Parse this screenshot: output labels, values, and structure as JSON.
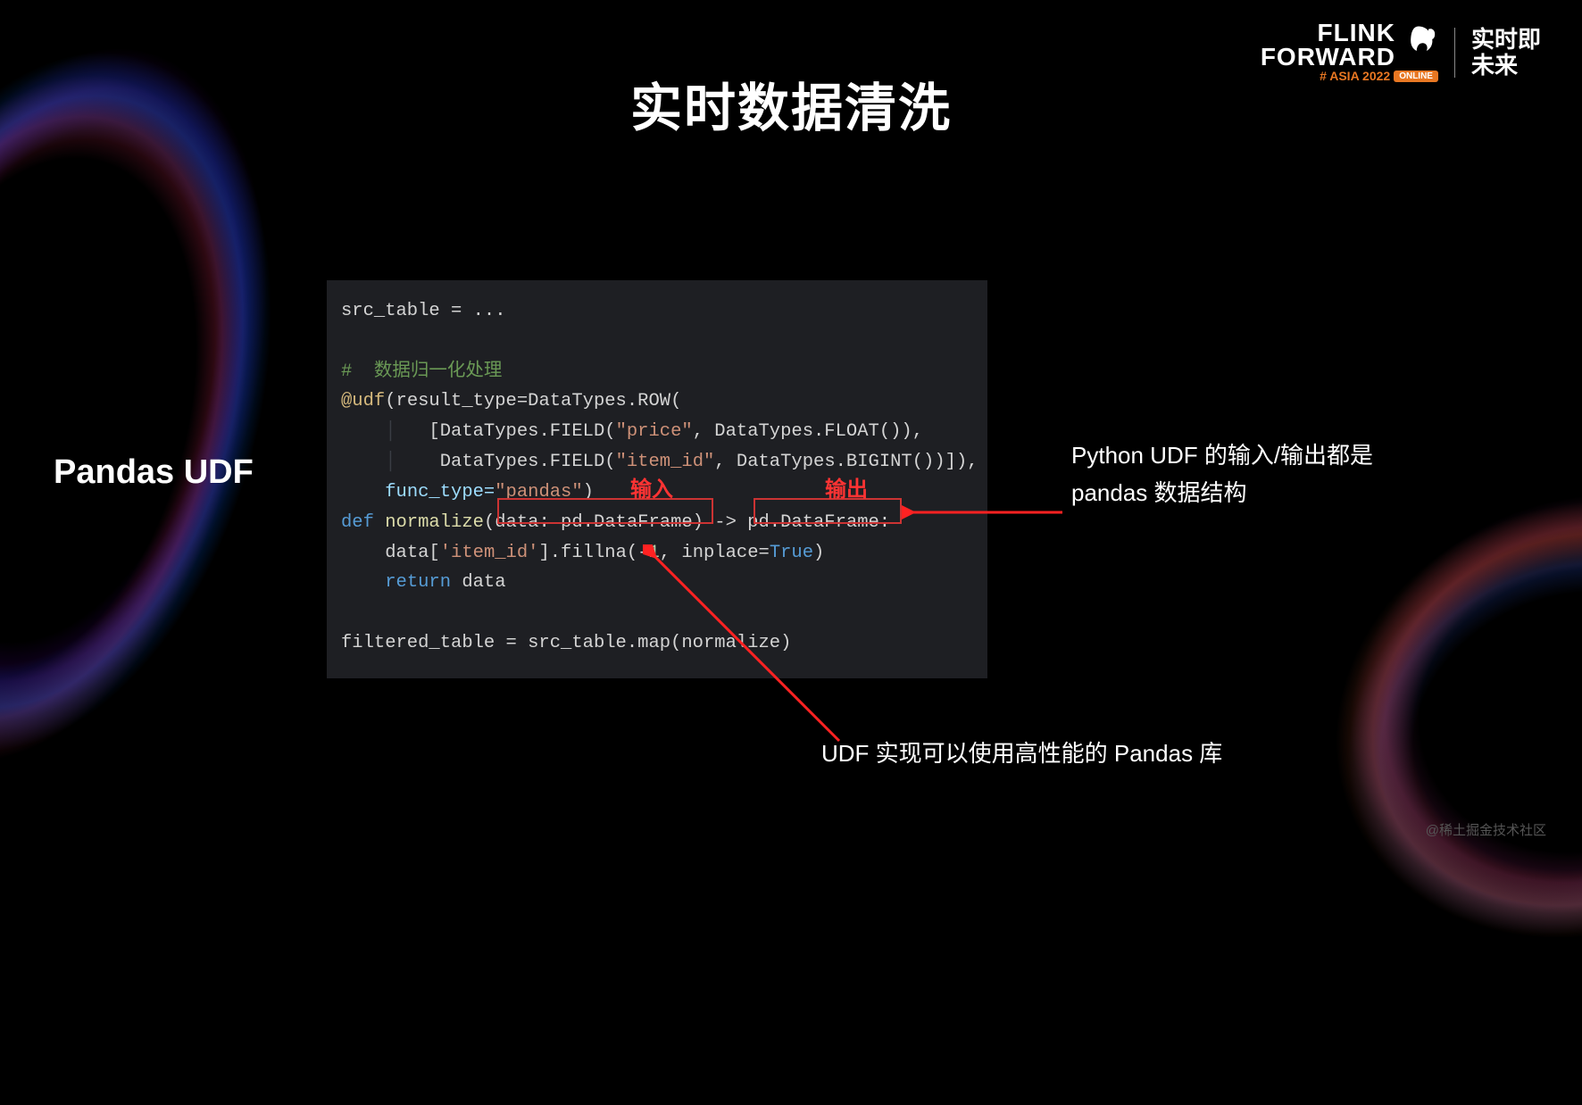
{
  "logo": {
    "line1": "FLINK",
    "line2": "FORWARD",
    "asia": "# ASIA 2022",
    "online": "ONLINE",
    "cn_line1": "实时即",
    "cn_line2": "未来"
  },
  "slide": {
    "title": "实时数据清洗",
    "side_label": "Pandas UDF"
  },
  "code": {
    "l1": "src_table = ...",
    "l2_comment": "#  数据归一化处理",
    "l3_deco": "@udf",
    "l3_a": "(result_type=DataTypes.ROW(",
    "l4_a": "[DataTypes.FIELD(",
    "l4_s1": "\"price\"",
    "l4_b": ", DataTypes.FLOAT()),",
    "l5_a": "DataTypes.FIELD(",
    "l5_s1": "\"item_id\"",
    "l5_b": ", DataTypes.BIGINT())]),",
    "l6_a": "func_type=",
    "l6_s1": "\"pandas\"",
    "l6_b": ")",
    "l7_def": "def",
    "l7_name": " normalize",
    "l7_a": "(data: pd.DataFrame) -> pd.DataFrame:",
    "l8_a": "data[",
    "l8_s1": "'item_id'",
    "l8_b": "].fillna(-",
    "l8_n1": "1",
    "l8_c": ", inplace=",
    "l8_bool": "True",
    "l8_d": ")",
    "l9_ret": "return",
    "l9_a": " data",
    "l10": "filtered_table = src_table.map(normalize)"
  },
  "highlights": {
    "input": "输入",
    "output": "输出"
  },
  "annotations": {
    "right_l1": "Python UDF 的输入/输出都是",
    "right_l2": "pandas 数据结构",
    "bottom": "UDF 实现可以使用高性能的 Pandas 库"
  },
  "watermark": "@稀土掘金技术社区"
}
